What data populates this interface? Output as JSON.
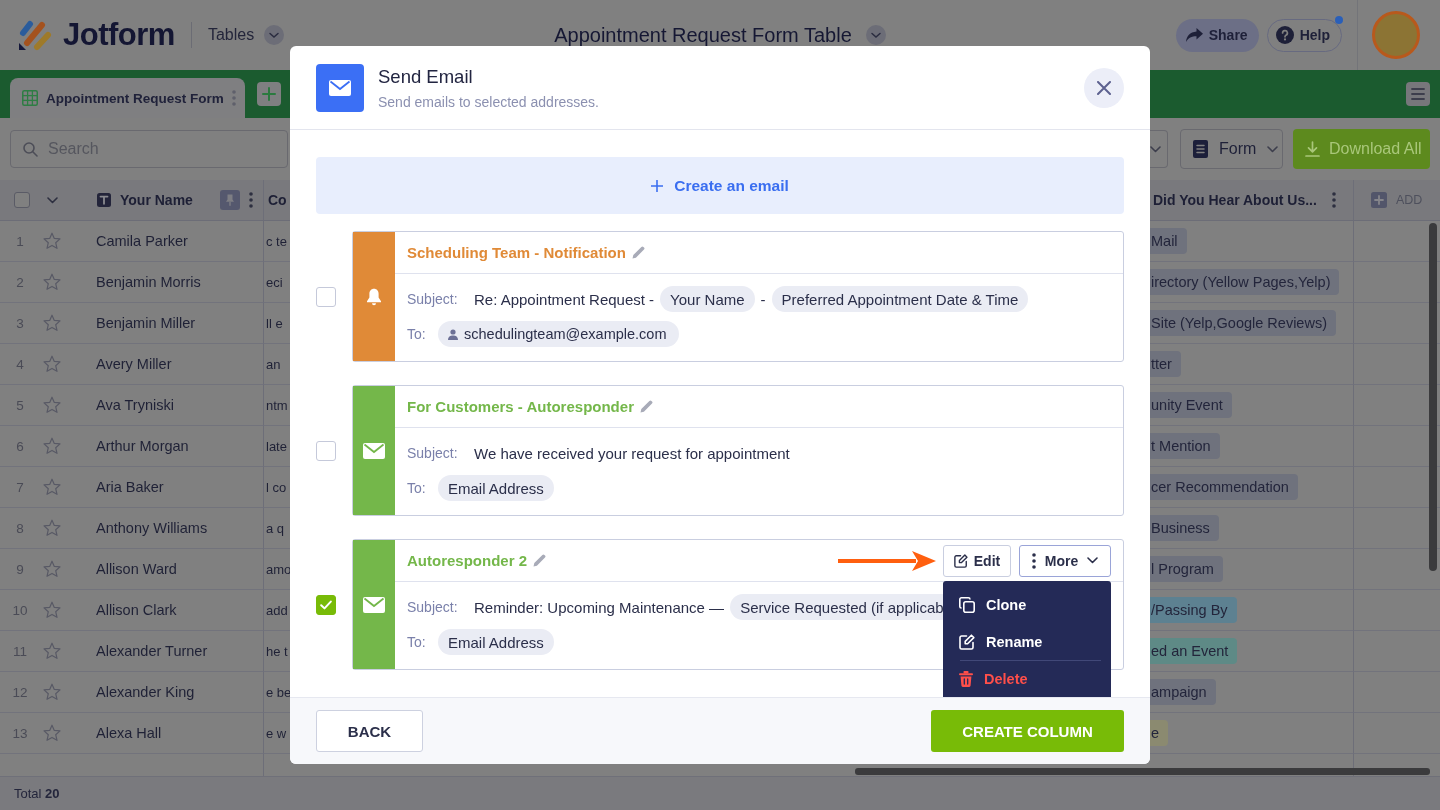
{
  "header": {
    "brand": "Jotform",
    "app_switcher": "Tables",
    "title": "Appointment Request Form Table",
    "share_button": "Share",
    "help_button": "Help",
    "help_notification": true
  },
  "tabs": [
    {
      "label": "Appointment Request Form",
      "selected": true
    }
  ],
  "toolbar": {
    "search": {
      "placeholder": "Search"
    },
    "view_button": "Form",
    "download_button": "Download All"
  },
  "table": {
    "select_all": {
      "checked": false
    },
    "name_column": "Your Name",
    "column_3": "Co",
    "source_column": "Did You Hear About Us...",
    "add_column": "ADD",
    "rows": [
      {
        "number": "1",
        "starred": false,
        "your_name": "Camila Parker",
        "column_3": "c te",
        "source": {
          "label": "Mail",
          "color": "#6f727d"
        }
      },
      {
        "number": "2",
        "starred": false,
        "your_name": "Benjamin Morris",
        "column_3": "eci",
        "source": {
          "label": "irectory (Yellow Pages,Yelp)",
          "color": "#6f727d"
        }
      },
      {
        "number": "3",
        "starred": false,
        "your_name": "Benjamin Miller",
        "column_3": "ll e",
        "source": {
          "label": "Site (Yelp,Google Reviews)",
          "color": "#6f727d"
        }
      },
      {
        "number": "4",
        "starred": false,
        "your_name": "Avery Miller",
        "column_3": "an",
        "source": {
          "label": "tter",
          "color": "#6f727d"
        }
      },
      {
        "number": "5",
        "starred": false,
        "your_name": "Ava Tryniski",
        "column_3": "ntm",
        "source": {
          "label": "unity Event",
          "color": "#6f727d"
        }
      },
      {
        "number": "6",
        "starred": false,
        "your_name": "Arthur Morgan",
        "column_3": "late",
        "source": {
          "label": "t Mention",
          "color": "#6f727d"
        }
      },
      {
        "number": "7",
        "starred": false,
        "your_name": "Aria Baker",
        "column_3": "l co",
        "source": {
          "label": "cer Recommendation",
          "color": "#6f727d"
        }
      },
      {
        "number": "8",
        "starred": false,
        "your_name": "Anthony Williams",
        "column_3": "a q",
        "source": {
          "label": "Business",
          "color": "#6f727d"
        }
      },
      {
        "number": "9",
        "starred": false,
        "your_name": "Allison Ward",
        "column_3": "amo",
        "source": {
          "label": "l Program",
          "color": "#6f727d"
        }
      },
      {
        "number": "10",
        "starred": false,
        "your_name": "Allison Clark",
        "column_3": "add",
        "source": {
          "label": "/Passing By",
          "color": "#5d8191"
        }
      },
      {
        "number": "11",
        "starred": false,
        "your_name": "Alexander Turner",
        "column_3": "he t",
        "source": {
          "label": "ed an Event",
          "color": "#5e8a86"
        }
      },
      {
        "number": "12",
        "starred": false,
        "your_name": "Alexander King",
        "column_3": "e be",
        "source": {
          "label": "ampaign",
          "color": "#6f727d"
        }
      },
      {
        "number": "13",
        "starred": false,
        "your_name": "Alexa Hall",
        "column_3": "e w",
        "source": {
          "label": "e",
          "color": "#8b8a70"
        }
      }
    ]
  },
  "footer": {
    "total": "Total **20**"
  },
  "modal": {
    "title": "Send Email",
    "subtitle": "Send emails to selected addresses.",
    "create_button": "Create an email",
    "emails": [
      {
        "kind": "notification",
        "color": "#e08a37",
        "title": "Scheduling Team - Notification",
        "selected": false,
        "subject_label": "Subject:",
        "subject": [
          {
            "kind": "text",
            "text": "Re: Appointment Request -"
          },
          {
            "kind": "field",
            "text": "Your Name"
          },
          {
            "kind": "text",
            "text": "-"
          },
          {
            "kind": "field",
            "text": "Preferred Appointment Date & Time"
          }
        ],
        "to_label": "To:",
        "to": [
          {
            "kind": "address",
            "text": "schedulingteam@example.com"
          }
        ]
      },
      {
        "kind": "autoresponder",
        "color": "#74b74a",
        "title": "For Customers - Autoresponder",
        "selected": false,
        "subject_label": "Subject:",
        "subject": [
          {
            "kind": "text",
            "text": "We have received your request for appointment"
          }
        ],
        "to_label": "To:",
        "to": [
          {
            "kind": "field",
            "text": "Email Address"
          }
        ]
      },
      {
        "kind": "autoresponder",
        "color": "#74b74a",
        "title": "Autoresponder 2",
        "selected": true,
        "edit_button": "Edit",
        "more_button": "More",
        "menu": {
          "expanded": true,
          "items": [
            {
              "kind": "clone",
              "label": "Clone"
            },
            {
              "kind": "rename",
              "label": "Rename"
            },
            {
              "kind": "delete",
              "label": "Delete"
            }
          ]
        },
        "subject_label": "Subject:",
        "subject": [
          {
            "kind": "text",
            "text": "Reminder: Upcoming Maintenance —"
          },
          {
            "kind": "field",
            "text": "Service Requested (if applicab"
          }
        ],
        "to_label": "To:",
        "to": [
          {
            "kind": "field",
            "text": "Email Address"
          }
        ]
      }
    ],
    "back_button": "BACK",
    "create_column_button": "CREATE COLUMN"
  }
}
